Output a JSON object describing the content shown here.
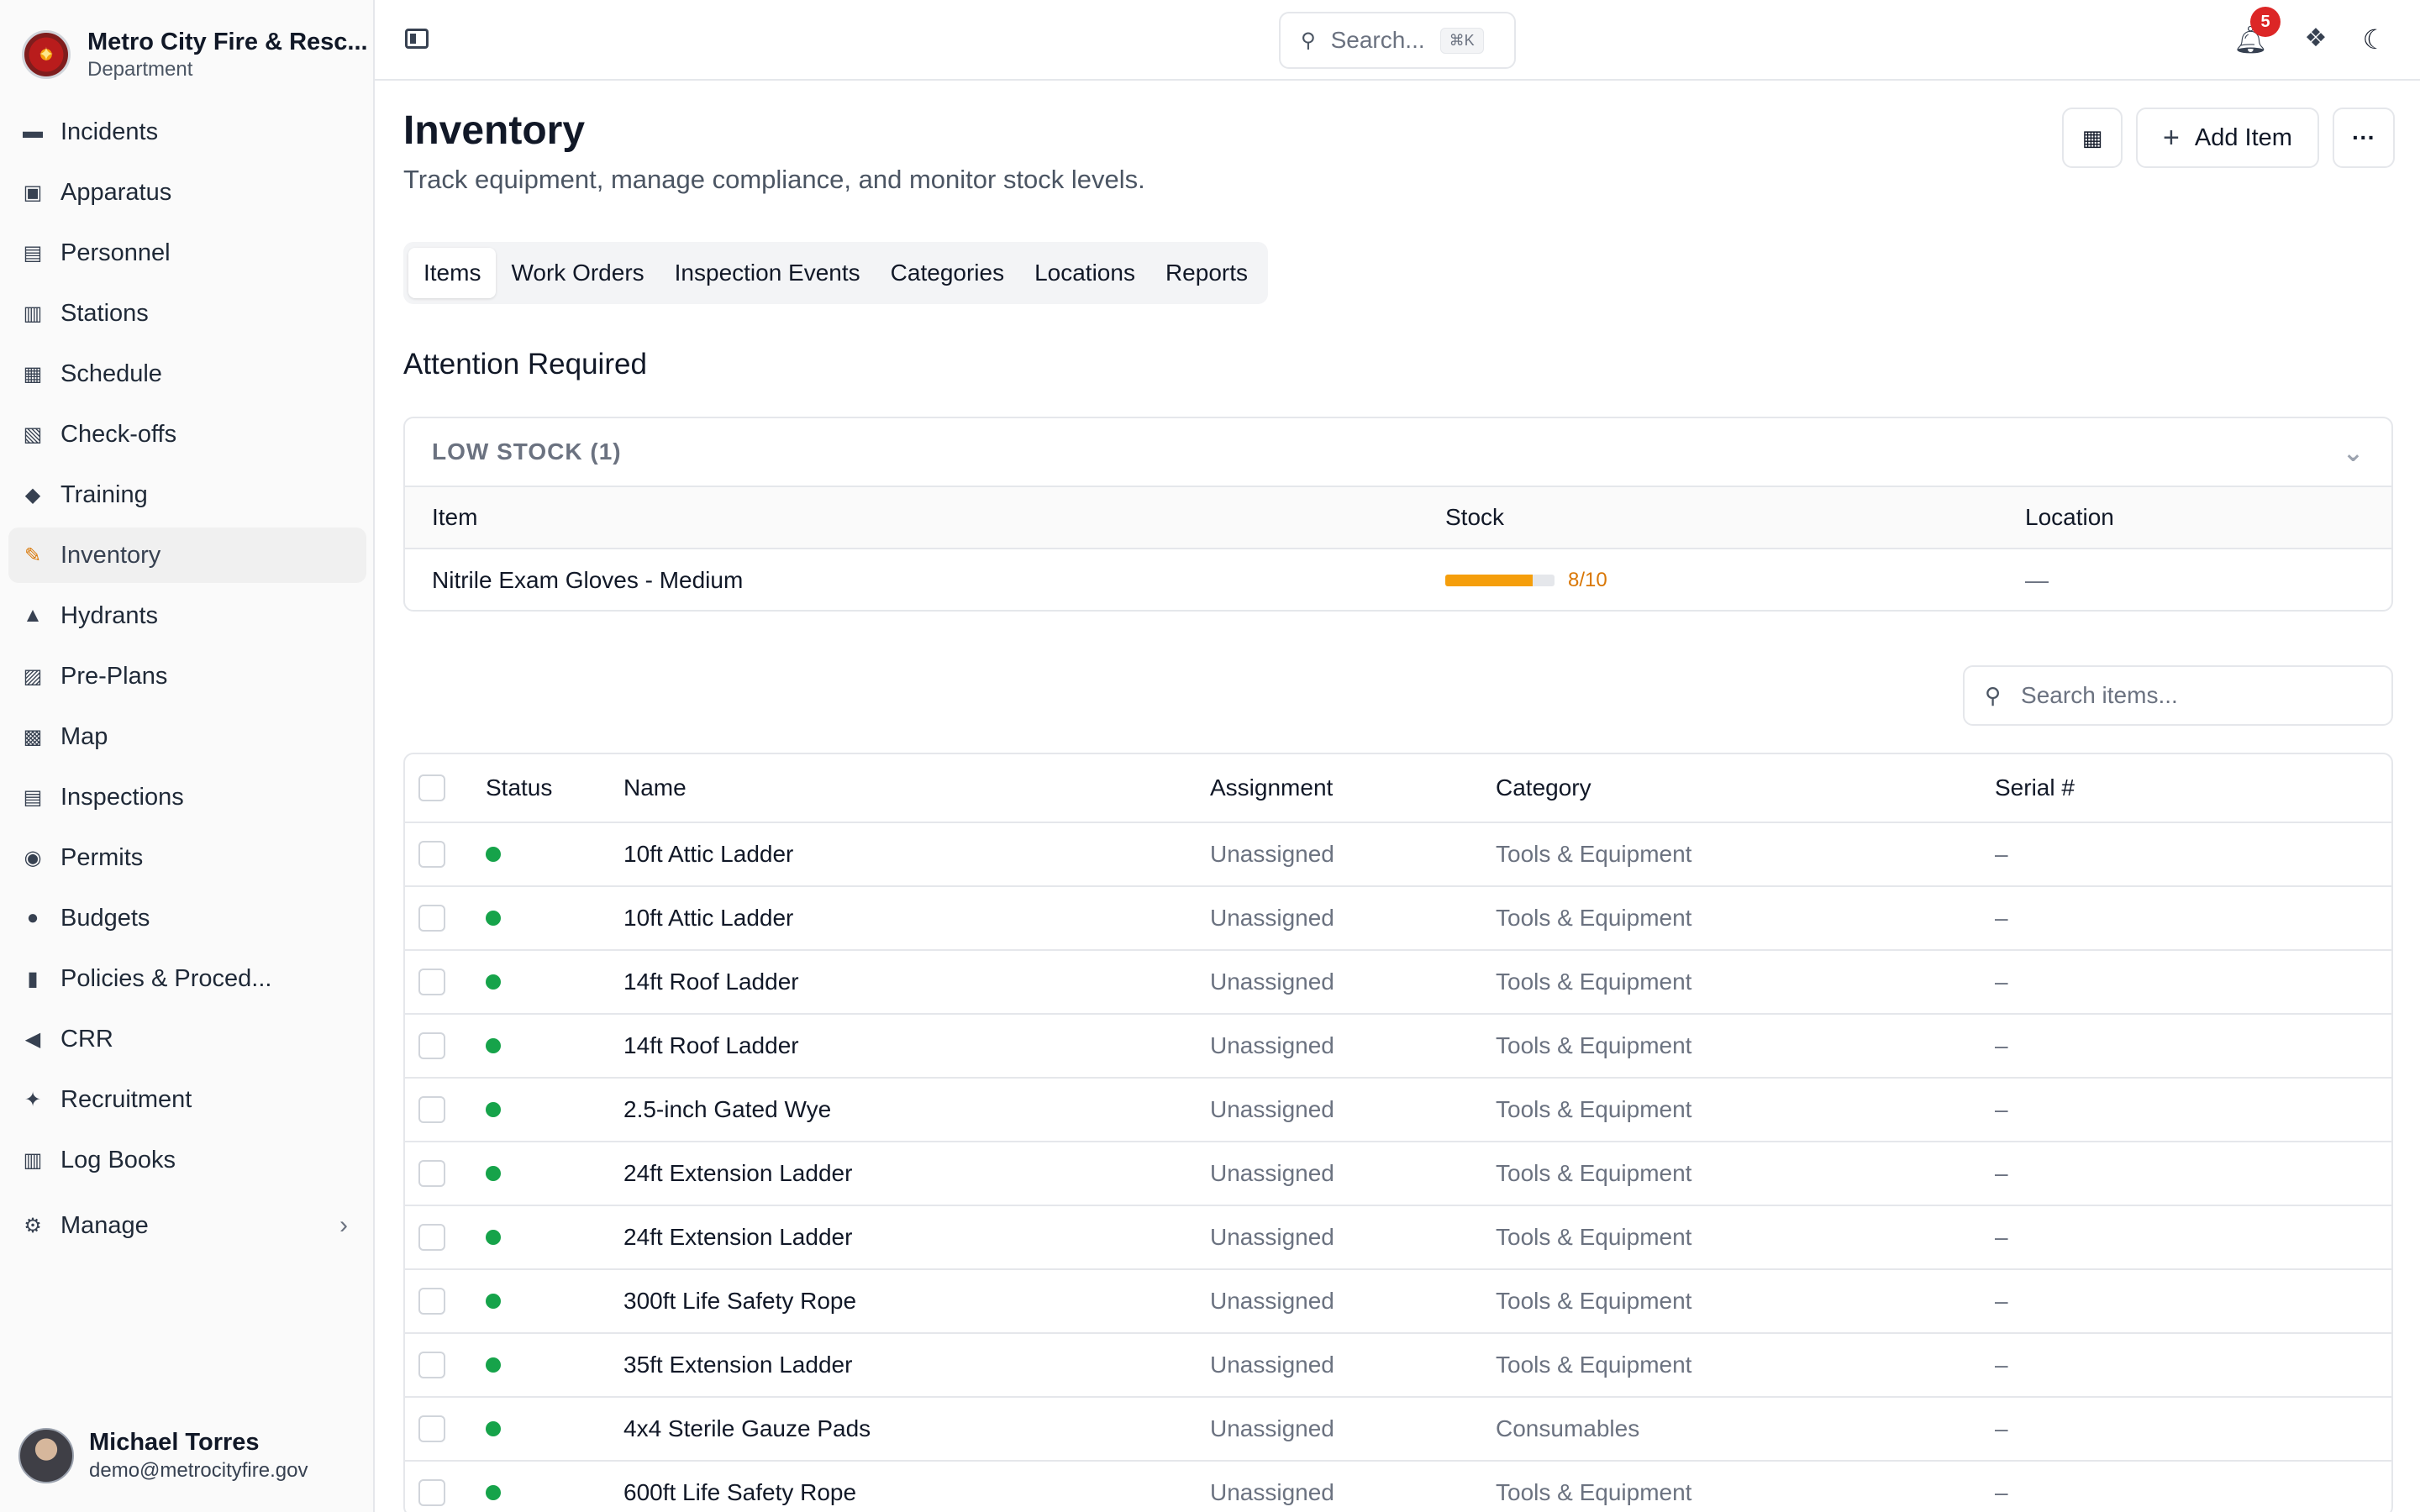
{
  "org": {
    "name": "Metro City Fire & Resc...",
    "sub": "Department"
  },
  "nav": {
    "items": [
      {
        "label": "Incidents",
        "icon": "incidents-icon",
        "glyph": "▬"
      },
      {
        "label": "Apparatus",
        "icon": "apparatus-icon",
        "glyph": "▣"
      },
      {
        "label": "Personnel",
        "icon": "personnel-icon",
        "glyph": "▤"
      },
      {
        "label": "Stations",
        "icon": "stations-icon",
        "glyph": "▥"
      },
      {
        "label": "Schedule",
        "icon": "schedule-icon",
        "glyph": "▦"
      },
      {
        "label": "Check-offs",
        "icon": "checkoffs-icon",
        "glyph": "▧"
      },
      {
        "label": "Training",
        "icon": "training-icon",
        "glyph": "◆"
      },
      {
        "label": "Inventory",
        "icon": "inventory-icon",
        "glyph": "✎",
        "active": true
      },
      {
        "label": "Hydrants",
        "icon": "hydrant-icon",
        "glyph": "▲"
      },
      {
        "label": "Pre-Plans",
        "icon": "preplans-icon",
        "glyph": "▨"
      },
      {
        "label": "Map",
        "icon": "map-icon",
        "glyph": "▩"
      },
      {
        "label": "Inspections",
        "icon": "inspections-icon",
        "glyph": "▤"
      },
      {
        "label": "Permits",
        "icon": "permits-icon",
        "glyph": "◉"
      },
      {
        "label": "Budgets",
        "icon": "budgets-icon",
        "glyph": "●"
      },
      {
        "label": "Policies & Proced...",
        "icon": "policies-icon",
        "glyph": "▮"
      },
      {
        "label": "CRR",
        "icon": "megaphone-icon",
        "glyph": "◀"
      },
      {
        "label": "Recruitment",
        "icon": "handshake-icon",
        "glyph": "✦"
      },
      {
        "label": "Log Books",
        "icon": "books-icon",
        "glyph": "▥"
      }
    ],
    "manage_label": "Manage"
  },
  "user": {
    "name": "Michael Torres",
    "email": "demo@metrocityfire.gov"
  },
  "topbar": {
    "search_label": "Search...",
    "search_shortcut": "⌘K",
    "notification_count": "5"
  },
  "page": {
    "title": "Inventory",
    "subtitle": "Track equipment, manage compliance, and monitor stock levels.",
    "add_label": "Add Item",
    "more_label": "···"
  },
  "tabs": [
    "Items",
    "Work Orders",
    "Inspection Events",
    "Categories",
    "Locations",
    "Reports"
  ],
  "attention": {
    "title": "Attention Required",
    "group_label": "LOW STOCK (1)",
    "columns": {
      "item": "Item",
      "stock": "Stock",
      "location": "Location"
    },
    "rows": [
      {
        "item": "Nitrile Exam Gloves - Medium",
        "stock_text": "8/10",
        "stock_fraction": 0.8,
        "location": "—"
      }
    ]
  },
  "items_search": {
    "placeholder": "Search items..."
  },
  "items": {
    "columns": {
      "status": "Status",
      "name": "Name",
      "assignment": "Assignment",
      "category": "Category",
      "serial": "Serial #"
    },
    "rows": [
      {
        "name": "10ft Attic Ladder",
        "assignment": "Unassigned",
        "category": "Tools & Equipment",
        "serial": "–"
      },
      {
        "name": "10ft Attic Ladder",
        "assignment": "Unassigned",
        "category": "Tools & Equipment",
        "serial": "–"
      },
      {
        "name": "14ft Roof Ladder",
        "assignment": "Unassigned",
        "category": "Tools & Equipment",
        "serial": "–"
      },
      {
        "name": "14ft Roof Ladder",
        "assignment": "Unassigned",
        "category": "Tools & Equipment",
        "serial": "–"
      },
      {
        "name": "2.5-inch Gated Wye",
        "assignment": "Unassigned",
        "category": "Tools & Equipment",
        "serial": "–"
      },
      {
        "name": "24ft Extension Ladder",
        "assignment": "Unassigned",
        "category": "Tools & Equipment",
        "serial": "–"
      },
      {
        "name": "24ft Extension Ladder",
        "assignment": "Unassigned",
        "category": "Tools & Equipment",
        "serial": "–"
      },
      {
        "name": "300ft Life Safety Rope",
        "assignment": "Unassigned",
        "category": "Tools & Equipment",
        "serial": "–"
      },
      {
        "name": "35ft Extension Ladder",
        "assignment": "Unassigned",
        "category": "Tools & Equipment",
        "serial": "–"
      },
      {
        "name": "4x4 Sterile Gauze Pads",
        "assignment": "Unassigned",
        "category": "Consumables",
        "serial": "–"
      },
      {
        "name": "600ft Life Safety Rope",
        "assignment": "Unassigned",
        "category": "Tools & Equipment",
        "serial": "–"
      }
    ]
  },
  "colors": {
    "accent_active": "#d97706",
    "status_ok": "#16a34a",
    "badge": "#dc2626",
    "stock_warn": "#f59e0b"
  }
}
